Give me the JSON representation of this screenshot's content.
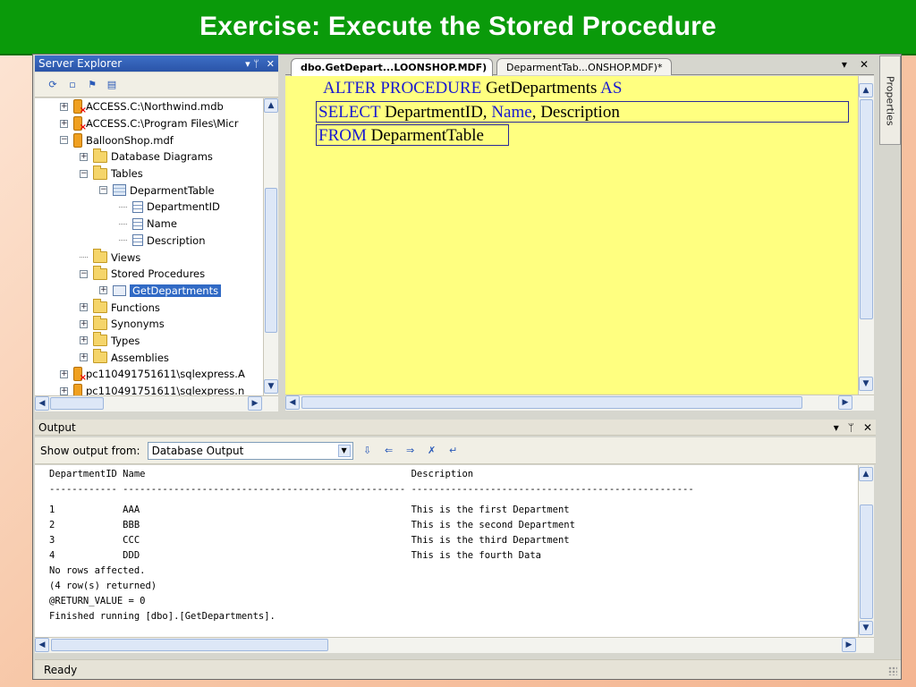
{
  "banner": {
    "title": "Exercise: Execute the Stored Procedure"
  },
  "server_explorer": {
    "title": "Server Explorer",
    "pin": "▾ ᛘ",
    "close": "✕",
    "tree": [
      {
        "label": "ACCESS.C:\\Northwind.mdb",
        "icon": "database-error-icon",
        "expander": "+",
        "indent": 0
      },
      {
        "label": "ACCESS.C:\\Program Files\\Micr",
        "icon": "database-error-icon",
        "expander": "+",
        "indent": 0
      },
      {
        "label": "BalloonShop.mdf",
        "icon": "database-icon",
        "expander": "−",
        "indent": 0
      },
      {
        "label": "Database Diagrams",
        "icon": "folder-icon",
        "expander": "+",
        "indent": 1
      },
      {
        "label": "Tables",
        "icon": "folder-icon",
        "expander": "−",
        "indent": 1
      },
      {
        "label": "DeparmentTable",
        "icon": "table-icon",
        "expander": "−",
        "indent": 2
      },
      {
        "label": "DepartmentID",
        "icon": "column-icon",
        "expander": "",
        "indent": 3
      },
      {
        "label": "Name",
        "icon": "column-icon",
        "expander": "",
        "indent": 3
      },
      {
        "label": "Description",
        "icon": "column-icon",
        "expander": "",
        "indent": 3
      },
      {
        "label": "Views",
        "icon": "folder-icon",
        "expander": "",
        "indent": 1
      },
      {
        "label": "Stored Procedures",
        "icon": "folder-icon",
        "expander": "−",
        "indent": 1
      },
      {
        "label": "GetDepartments",
        "icon": "procedure-icon",
        "expander": "+",
        "indent": 2,
        "selected": true
      },
      {
        "label": "Functions",
        "icon": "folder-icon",
        "expander": "+",
        "indent": 1
      },
      {
        "label": "Synonyms",
        "icon": "folder-icon",
        "expander": "+",
        "indent": 1
      },
      {
        "label": "Types",
        "icon": "folder-icon",
        "expander": "+",
        "indent": 1
      },
      {
        "label": "Assemblies",
        "icon": "folder-icon",
        "expander": "+",
        "indent": 1
      },
      {
        "label": "pc110491751611\\sqlexpress.A",
        "icon": "database-error-icon",
        "expander": "+",
        "indent": 0
      },
      {
        "label": "pc110491751611\\sqlexpress.n",
        "icon": "database-icon",
        "expander": "+",
        "indent": 0
      }
    ]
  },
  "editor": {
    "tabs": [
      {
        "label": "dbo.GetDepart...LOONSHOP.MDF)",
        "active": true
      },
      {
        "label": "DeparmentTab...ONSHOP.MDF)*",
        "active": false
      }
    ],
    "tab_menu": "▾",
    "tab_close": "✕",
    "lines": [
      [
        {
          "t": "ALTER PROCEDURE",
          "k": true
        },
        {
          "t": " GetDepartments ",
          "k": false
        },
        {
          "t": "AS",
          "k": true
        }
      ],
      [
        {
          "t": "SELECT",
          "k": true
        },
        {
          "t": " DepartmentID, ",
          "k": false
        },
        {
          "t": "Name",
          "k": true
        },
        {
          "t": ", Description",
          "k": false
        }
      ],
      [
        {
          "t": "FROM",
          "k": true
        },
        {
          "t": " DeparmentTable",
          "k": false
        }
      ]
    ]
  },
  "properties_tab": {
    "label": "Properties"
  },
  "output": {
    "title": "Output",
    "show_from_label": "Show output from:",
    "show_from_value": "Database Output",
    "lines": [
      "DepartmentID Name                                               Description",
      "------------ -------------------------------------------------- --------------------------------------------------",
      "1            AAA                                                This is the first Department",
      "2            BBB                                                This is the second Department",
      "3            CCC                                                This is the third Department",
      "4            DDD                                                This is the fourth Data",
      "No rows affected.",
      "(4 row(s) returned)",
      "@RETURN_VALUE = 0",
      "Finished running [dbo].[GetDepartments]."
    ]
  },
  "status": {
    "text": "Ready"
  },
  "colors": {
    "banner": "#0a9a0a",
    "editor_bg": "#ffff80",
    "keyword": "#1a1ad0",
    "selection": "#316ac5"
  }
}
